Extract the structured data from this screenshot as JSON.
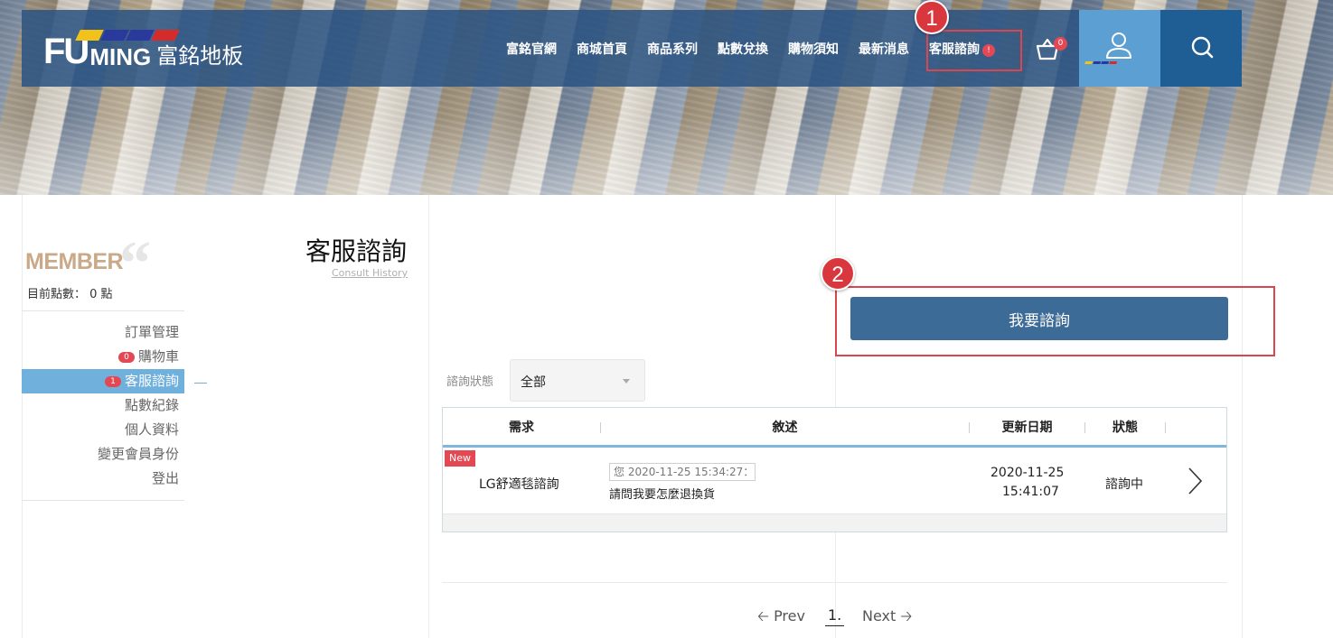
{
  "header": {
    "logo": {
      "fu": "FU",
      "ming": "MING",
      "cn": "富銘地板",
      "stripe_colors": [
        "#f2c21b",
        "#2a3a9c",
        "#2a3a9c",
        "#d62b2b"
      ]
    },
    "nav": [
      {
        "label": "富銘官網"
      },
      {
        "label": "商城首頁"
      },
      {
        "label": "商品系列"
      },
      {
        "label": "點數兌換"
      },
      {
        "label": "購物須知"
      },
      {
        "label": "最新消息"
      },
      {
        "label": "客服諮詢",
        "badge": "!"
      }
    ],
    "cart_badge": "0"
  },
  "annotations": {
    "step1": "1",
    "step2": "2"
  },
  "sidebar": {
    "title": "MEMBER",
    "points": "目前點數： 0 點",
    "items": [
      {
        "label": "訂單管理"
      },
      {
        "label": "購物車",
        "badge": "0"
      },
      {
        "label": "客服諮詢",
        "badge": "1"
      },
      {
        "label": "點數紀錄"
      },
      {
        "label": "個人資料"
      },
      {
        "label": "變更會員身份"
      },
      {
        "label": "登出"
      }
    ]
  },
  "page": {
    "title": "客服諮詢",
    "subtitle": "Consult History"
  },
  "inquire_button": "我要諮詢",
  "filter": {
    "label": "諮詢狀態",
    "value": "全部"
  },
  "table": {
    "headers": [
      "需求",
      "敘述",
      "更新日期",
      "狀態"
    ],
    "rows": [
      {
        "badge": "New",
        "need": "LG舒適毯諮詢",
        "preview": "您 2020-11-25 15:34:27：",
        "desc": "請問我要怎麼退換貨",
        "date": "2020-11-25",
        "time": "15:41:07",
        "status": "諮詢中"
      }
    ]
  },
  "pagination": {
    "prev": "Prev",
    "current": "1.",
    "next": "Next"
  },
  "colors": {
    "header_bg": "#2b5482",
    "accent_blue": "#3d6b98",
    "active_blue": "#6fb0dc",
    "badge_red": "#e34853",
    "annotation_red": "#d9464e"
  }
}
